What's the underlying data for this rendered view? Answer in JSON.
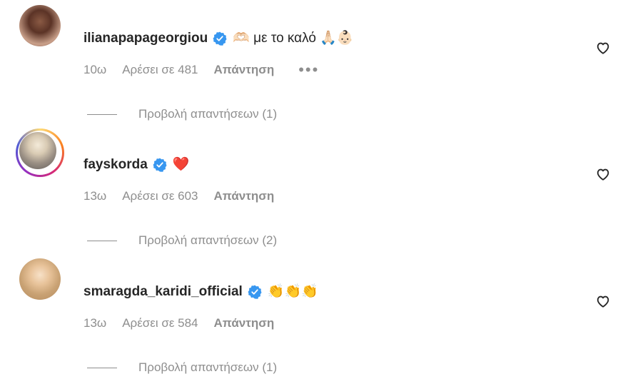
{
  "comments": [
    {
      "username": "ilianapapageorgiou",
      "text": "🫶🏻 με το καλό 🙏🏻👶🏻",
      "time": "10ω",
      "likes": "Αρέσει σε 481",
      "reply": "Απάντηση",
      "more": "•••",
      "view_replies": "Προβολή απαντήσεων (1)",
      "story_ring": false
    },
    {
      "username": "fayskorda",
      "text": "❤️",
      "time": "13ω",
      "likes": "Αρέσει σε 603",
      "reply": "Απάντηση",
      "view_replies": "Προβολή απαντήσεων (2)",
      "story_ring": true
    },
    {
      "username": "smaragda_karidi_official",
      "text": "👏👏👏",
      "time": "13ω",
      "likes": "Αρέσει σε 584",
      "reply": "Απάντηση",
      "view_replies": "Προβολή απαντήσεων (1)",
      "story_ring": false
    }
  ],
  "colors": {
    "verified_badge": "#3897f0",
    "heart_red": "#ed4956",
    "muted_text": "#8e8e8e"
  },
  "icons": {
    "like": "heart-outline-icon",
    "verified": "verified-badge-icon"
  }
}
